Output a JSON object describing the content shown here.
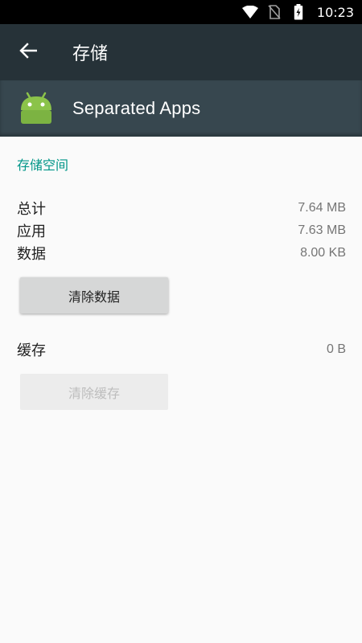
{
  "status_bar": {
    "time": "10:23",
    "icons": [
      "wifi-icon",
      "no-sim-icon",
      "battery-charging-icon"
    ]
  },
  "toolbar": {
    "back_icon": "arrow-back-icon",
    "title": "存储"
  },
  "app_header": {
    "icon": "android-icon",
    "name": "Separated Apps"
  },
  "storage": {
    "section_title": "存储空间",
    "rows": [
      {
        "label": "总计",
        "value": "7.64 MB"
      },
      {
        "label": "应用",
        "value": "7.63 MB"
      },
      {
        "label": "数据",
        "value": "8.00 KB"
      }
    ],
    "clear_data_label": "清除数据"
  },
  "cache": {
    "label": "缓存",
    "value": "0 B",
    "clear_cache_label": "清除缓存"
  },
  "colors": {
    "status_bar": "#000000",
    "toolbar": "#263238",
    "app_header": "#37474f",
    "accent": "#009688",
    "android_green": "#8bc34a",
    "background": "#fafafa"
  }
}
